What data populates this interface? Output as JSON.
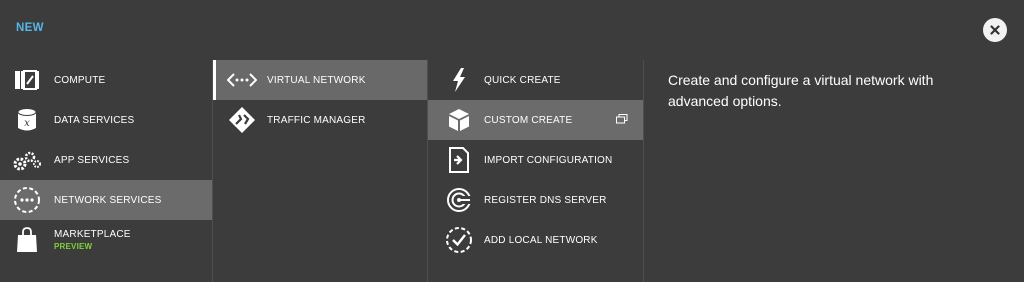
{
  "header": {
    "title": "NEW"
  },
  "categories": [
    {
      "label": "COMPUTE"
    },
    {
      "label": "DATA SERVICES"
    },
    {
      "label": "APP SERVICES"
    },
    {
      "label": "NETWORK SERVICES"
    },
    {
      "label": "MARKETPLACE",
      "sub": "PREVIEW"
    }
  ],
  "services": [
    {
      "label": "VIRTUAL NETWORK"
    },
    {
      "label": "TRAFFIC MANAGER"
    }
  ],
  "actions": [
    {
      "label": "QUICK CREATE"
    },
    {
      "label": "CUSTOM CREATE"
    },
    {
      "label": "IMPORT CONFIGURATION"
    },
    {
      "label": "REGISTER DNS SERVER"
    },
    {
      "label": "ADD LOCAL NETWORK"
    }
  ],
  "description": "Create and configure a virtual network with advanced options.",
  "colors": {
    "accent": "#54b6e6",
    "preview": "#7fd13b",
    "background": "#3c3c3c",
    "selected": "#6b6b6b"
  }
}
